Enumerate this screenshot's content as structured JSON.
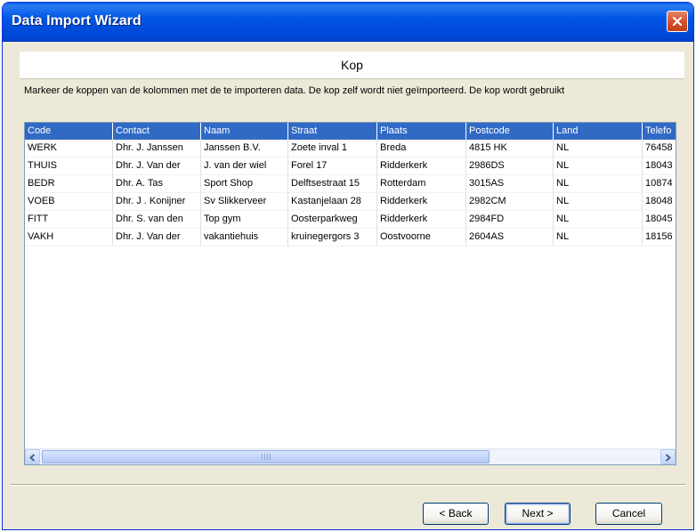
{
  "window": {
    "title": "Data Import Wizard"
  },
  "header": {
    "title": "Kop"
  },
  "instructions": "Markeer de koppen van de kolommen met de te importeren data. De kop zelf wordt niet geïmporteerd. De kop wordt gebruikt",
  "table": {
    "columns": [
      "Code",
      "Contact",
      "Naam",
      "Straat",
      "Plaats",
      "Postcode",
      "Land",
      "Telefo"
    ],
    "rows": [
      [
        "WERK",
        "Dhr. J. Janssen",
        "Janssen B.V.",
        "Zoete inval 1",
        "Breda",
        "4815 HK",
        "NL",
        "76458"
      ],
      [
        "THUIS",
        "Dhr. J. Van der",
        "J. van der wiel",
        "Forel 17",
        "Ridderkerk",
        "2986DS",
        "NL",
        "18043"
      ],
      [
        "BEDR",
        "Dhr. A. Tas",
        "Sport Shop",
        "Delftsestraat 15",
        "Rotterdam",
        "3015AS",
        "NL",
        "10874"
      ],
      [
        "VOEB",
        "Dhr. J . Konijner",
        "Sv Slikkerveer",
        "Kastanjelaan 28",
        "Ridderkerk",
        "2982CM",
        "NL",
        "18048"
      ],
      [
        "FITT",
        "Dhr. S. van den",
        "Top gym",
        "Oosterparkweg",
        "Ridderkerk",
        "2984FD",
        "NL",
        "18045"
      ],
      [
        "VAKH",
        "Dhr. J. Van der",
        "vakantiehuis",
        "kruinegergors 3",
        "Oostvoorne",
        "2604AS",
        "NL",
        "18156"
      ]
    ]
  },
  "scrollbar": {
    "position": 0.0
  },
  "buttons": {
    "back": "< Back",
    "next": "Next >",
    "cancel": "Cancel"
  },
  "colors": {
    "titlebar": "#0055e5",
    "header_selection": "#316ac5",
    "dialog_background": "#ece9d8",
    "close_button": "#d6522c"
  }
}
